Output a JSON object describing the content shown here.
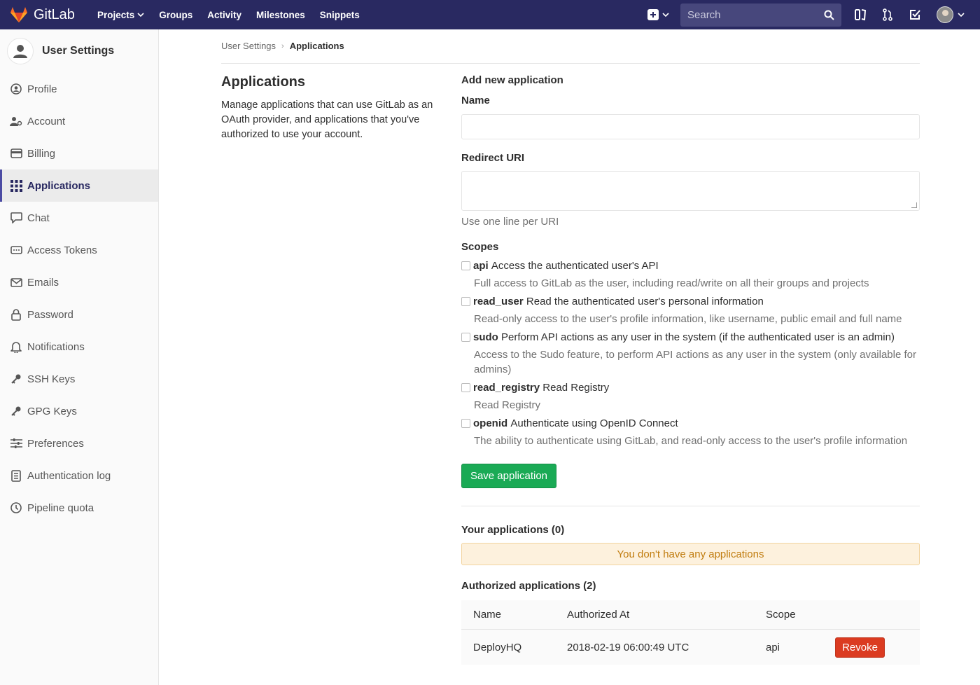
{
  "navbar": {
    "brand": "GitLab",
    "links": [
      "Projects",
      "Groups",
      "Activity",
      "Milestones",
      "Snippets"
    ],
    "search_placeholder": "Search",
    "color": "#292961"
  },
  "sidebar": {
    "title": "User Settings",
    "items": [
      {
        "label": "Profile",
        "icon": "profile-icon"
      },
      {
        "label": "Account",
        "icon": "account-icon"
      },
      {
        "label": "Billing",
        "icon": "billing-icon"
      },
      {
        "label": "Applications",
        "icon": "applications-icon",
        "active": true
      },
      {
        "label": "Chat",
        "icon": "chat-icon"
      },
      {
        "label": "Access Tokens",
        "icon": "access-tokens-icon"
      },
      {
        "label": "Emails",
        "icon": "emails-icon"
      },
      {
        "label": "Password",
        "icon": "password-icon"
      },
      {
        "label": "Notifications",
        "icon": "notifications-icon"
      },
      {
        "label": "SSH Keys",
        "icon": "ssh-keys-icon"
      },
      {
        "label": "GPG Keys",
        "icon": "gpg-keys-icon"
      },
      {
        "label": "Preferences",
        "icon": "preferences-icon"
      },
      {
        "label": "Authentication log",
        "icon": "authentication-log-icon"
      },
      {
        "label": "Pipeline quota",
        "icon": "pipeline-quota-icon"
      }
    ]
  },
  "breadcrumb": {
    "parent": "User Settings",
    "current": "Applications"
  },
  "intro": {
    "title": "Applications",
    "description": "Manage applications that can use GitLab as an OAuth provider, and applications that you've authorized to use your account."
  },
  "form": {
    "heading": "Add new application",
    "name_label": "Name",
    "name_value": "",
    "redirect_label": "Redirect URI",
    "redirect_value": "",
    "redirect_help": "Use one line per URI",
    "scopes_label": "Scopes",
    "scopes": [
      {
        "key": "api",
        "title": "Access the authenticated user's API",
        "description": "Full access to GitLab as the user, including read/write on all their groups and projects"
      },
      {
        "key": "read_user",
        "title": "Read the authenticated user's personal information",
        "description": "Read-only access to the user's profile information, like username, public email and full name"
      },
      {
        "key": "sudo",
        "title": "Perform API actions as any user in the system (if the authenticated user is an admin)",
        "description": "Access to the Sudo feature, to perform API actions as any user in the system (only available for admins)"
      },
      {
        "key": "read_registry",
        "title": "Read Registry",
        "description": "Read Registry"
      },
      {
        "key": "openid",
        "title": "Authenticate using OpenID Connect",
        "description": "The ability to authenticate using GitLab, and read-only access to the user's profile information"
      }
    ],
    "save_label": "Save application"
  },
  "your_apps": {
    "heading": "Your applications (0)",
    "empty_message": "You don't have any applications"
  },
  "authorized": {
    "heading": "Authorized applications (2)",
    "columns": [
      "Name",
      "Authorized At",
      "Scope"
    ],
    "rows": [
      {
        "name": "DeployHQ",
        "authorized_at": "2018-02-19 06:00:49 UTC",
        "scope": "api",
        "action": "Revoke"
      }
    ]
  }
}
